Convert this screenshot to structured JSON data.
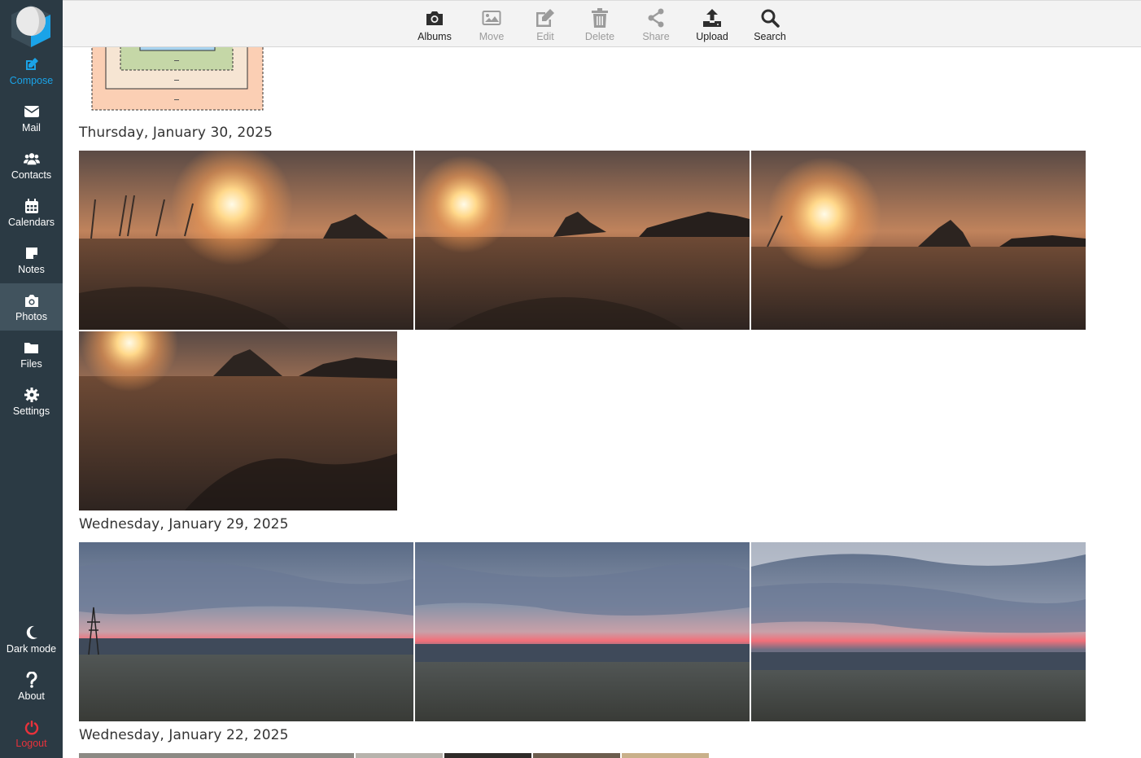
{
  "sidebar": {
    "items": [
      {
        "label": "Compose",
        "icon": "compose-icon"
      },
      {
        "label": "Mail",
        "icon": "mail-icon"
      },
      {
        "label": "Contacts",
        "icon": "contacts-icon"
      },
      {
        "label": "Calendars",
        "icon": "calendar-icon"
      },
      {
        "label": "Notes",
        "icon": "notes-icon"
      },
      {
        "label": "Photos",
        "icon": "camera-icon"
      },
      {
        "label": "Files",
        "icon": "folder-icon"
      },
      {
        "label": "Settings",
        "icon": "gear-icon"
      }
    ],
    "bottom": [
      {
        "label": "Dark mode",
        "icon": "moon-icon"
      },
      {
        "label": "About",
        "icon": "question-icon"
      },
      {
        "label": "Logout",
        "icon": "power-icon"
      }
    ],
    "active": "Photos",
    "colors": {
      "background": "#2b3a44",
      "active": "#41535e",
      "accent": "#1aa3e8",
      "danger": "#e8323b"
    }
  },
  "toolbar": {
    "buttons": [
      {
        "label": "Albums",
        "icon": "camera-icon",
        "enabled": true
      },
      {
        "label": "Move",
        "icon": "image-icon",
        "enabled": false
      },
      {
        "label": "Edit",
        "icon": "edit-icon",
        "enabled": false
      },
      {
        "label": "Delete",
        "icon": "trash-icon",
        "enabled": false
      },
      {
        "label": "Share",
        "icon": "share-icon",
        "enabled": false
      },
      {
        "label": "Upload",
        "icon": "upload-icon",
        "enabled": true
      },
      {
        "label": "Search",
        "icon": "search-icon",
        "enabled": true
      }
    ]
  },
  "groups": [
    {
      "date": "Thursday, January 30, 2025",
      "photos": 4,
      "scene": "sunrise"
    },
    {
      "date": "Wednesday, January 29, 2025",
      "photos": 3,
      "scene": "sunset"
    },
    {
      "date": "Wednesday, January 22, 2025",
      "photos": 7,
      "scene": "mixed"
    }
  ]
}
